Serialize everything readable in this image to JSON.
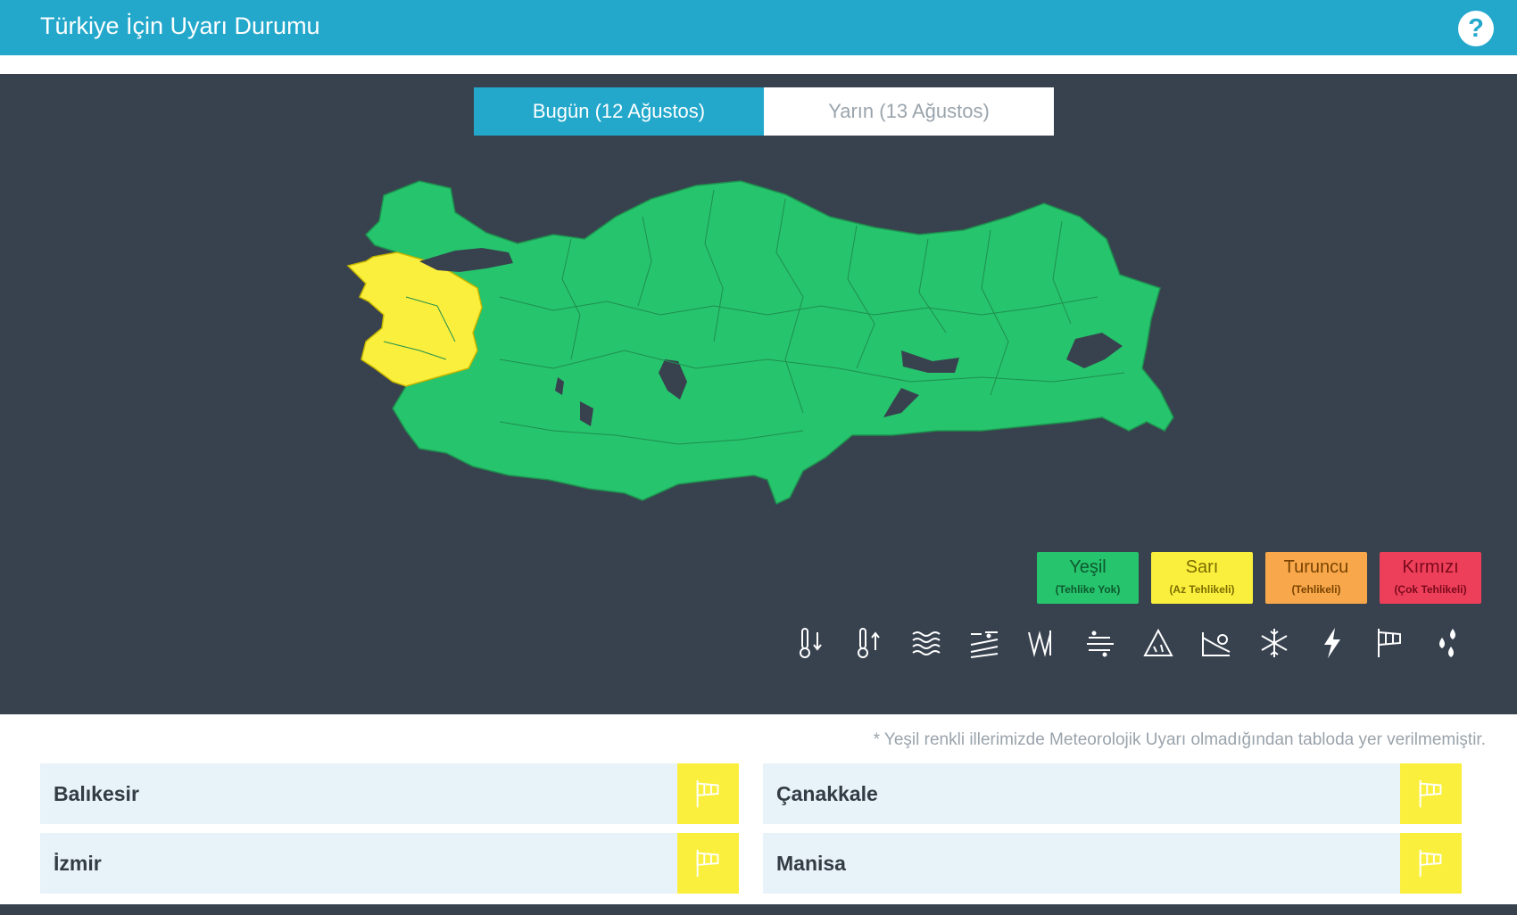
{
  "header": {
    "title": "Türkiye İçin Uyarı Durumu",
    "help_label": "?"
  },
  "tabs": [
    {
      "label": "Bugün (12 Ağustos)",
      "active": true
    },
    {
      "label": "Yarın (13 Ağustos)",
      "active": false
    }
  ],
  "map": {
    "warning_color": "#fbef3d",
    "safe_color": "#26c46c"
  },
  "legend": [
    {
      "name": "Yeşil",
      "desc": "(Tehlike Yok)",
      "color": "#26c46c"
    },
    {
      "name": "Sarı",
      "desc": "(Az Tehlikeli)",
      "color": "#fbef3d"
    },
    {
      "name": "Turuncu",
      "desc": "(Tehlikeli)",
      "color": "#f8a84b"
    },
    {
      "name": "Kırmızı",
      "desc": "(Çok Tehlikeli)",
      "color": "#ee3f5a"
    }
  ],
  "hazard_icons": [
    "cold-thermometer-icon",
    "hot-thermometer-icon",
    "fog-icon",
    "dust-icon",
    "avalanche-icon",
    "wind-icon",
    "landslide-icon",
    "flood-icon",
    "snow-icon",
    "lightning-icon",
    "windsock-icon",
    "rain-icon"
  ],
  "note": "* Yeşil renkli illerimizde Meteorolojik Uyarı olmadığından tabloda yer verilmemiştir.",
  "provinces": [
    {
      "name": "Balıkesir",
      "level_color": "#fbef3d",
      "icon": "windsock-icon"
    },
    {
      "name": "Çanakkale",
      "level_color": "#fbef3d",
      "icon": "windsock-icon"
    },
    {
      "name": "İzmir",
      "level_color": "#fbef3d",
      "icon": "windsock-icon"
    },
    {
      "name": "Manisa",
      "level_color": "#fbef3d",
      "icon": "windsock-icon"
    }
  ]
}
